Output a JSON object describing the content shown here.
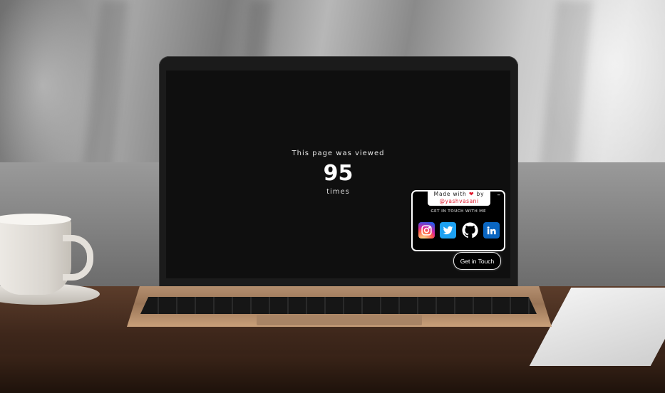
{
  "views": {
    "label": "This page was viewed",
    "count": "95",
    "unit": "times"
  },
  "widget": {
    "made_with_prefix": "Made with",
    "made_with_suffix": "by",
    "heart_icon": "heart-icon",
    "author_handle": "@yashvasani",
    "minimize_symbol": "–",
    "title": "GET IN TOUCH WITH ME",
    "social": [
      {
        "name": "instagram",
        "icon": "instagram-icon",
        "color": "#d6249f"
      },
      {
        "name": "twitter",
        "icon": "twitter-icon",
        "color": "#1da1f2"
      },
      {
        "name": "github",
        "icon": "github-icon",
        "color": "#ffffff"
      },
      {
        "name": "linkedin",
        "icon": "linkedin-icon",
        "color": "#0a66c2"
      }
    ]
  },
  "contact_button": {
    "label": "Get in Touch"
  }
}
